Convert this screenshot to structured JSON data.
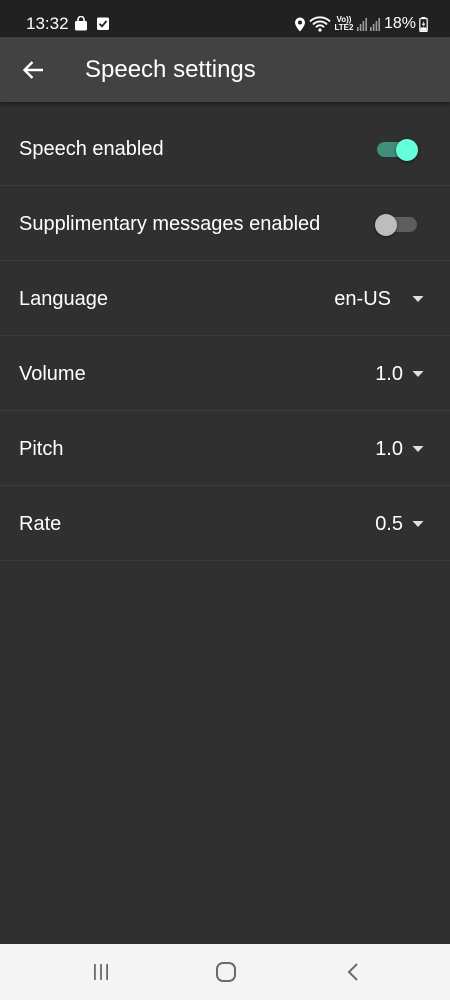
{
  "status_bar": {
    "time": "13:32",
    "network_label": "Vo)) LTE2",
    "battery_percent": "18%"
  },
  "app_bar": {
    "title": "Speech settings",
    "back_icon": "arrow-back-icon"
  },
  "settings": [
    {
      "label": "Speech enabled",
      "control": "switch",
      "checked": true
    },
    {
      "label": "Supplimentary messages enabled",
      "control": "switch",
      "checked": false
    },
    {
      "label": "Language",
      "control": "dropdown",
      "value": "en-US"
    },
    {
      "label": "Volume",
      "control": "dropdown",
      "value": "1.0"
    },
    {
      "label": "Pitch",
      "control": "dropdown",
      "value": "1.0"
    },
    {
      "label": "Rate",
      "control": "dropdown",
      "value": "0.5"
    }
  ],
  "colors": {
    "background": "#303030",
    "app_bar": "#424242",
    "status_bar": "#212121",
    "accent": "#64ffda",
    "accent_track": "#3f8f7a",
    "nav_bar": "#f4f4f4"
  },
  "nav_bar": {
    "buttons": [
      "recent-apps-icon",
      "home-icon",
      "back-nav-icon"
    ]
  }
}
